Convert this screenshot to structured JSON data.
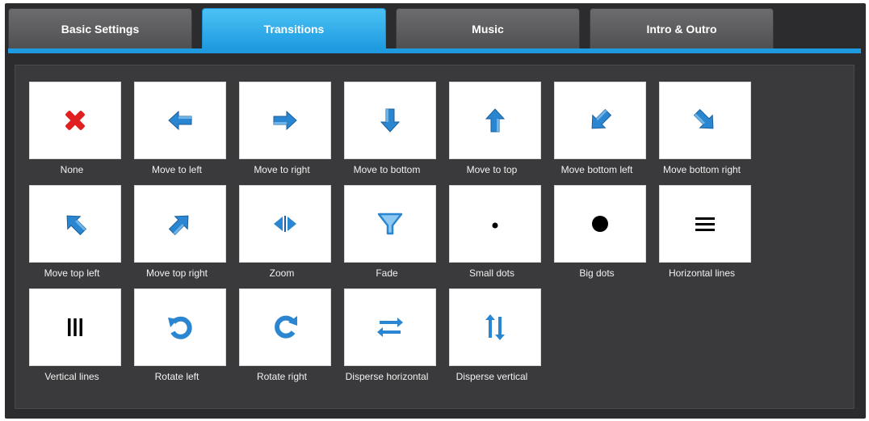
{
  "colors": {
    "accent": "#1e9be0",
    "icon_blue": "#2a86d1",
    "none_red": "#e02020",
    "panel_bg": "#3a3a3c",
    "frame_bg": "#2c2c2e"
  },
  "tabs": [
    {
      "label": "Basic Settings",
      "active": false
    },
    {
      "label": "Transitions",
      "active": true
    },
    {
      "label": "Music",
      "active": false
    },
    {
      "label": "Intro & Outro",
      "active": false
    }
  ],
  "transitions": [
    {
      "label": "None",
      "icon": "x-icon"
    },
    {
      "label": "Move to left",
      "icon": "arrow-left-icon"
    },
    {
      "label": "Move to right",
      "icon": "arrow-right-icon"
    },
    {
      "label": "Move to bottom",
      "icon": "arrow-down-icon"
    },
    {
      "label": "Move to top",
      "icon": "arrow-up-icon"
    },
    {
      "label": "Move bottom left",
      "icon": "arrow-down-left-icon"
    },
    {
      "label": "Move bottom right",
      "icon": "arrow-down-right-icon"
    },
    {
      "label": "Move top left",
      "icon": "arrow-up-left-icon"
    },
    {
      "label": "Move top right",
      "icon": "arrow-up-right-icon"
    },
    {
      "label": "Zoom",
      "icon": "zoom-icon"
    },
    {
      "label": "Fade",
      "icon": "funnel-icon"
    },
    {
      "label": "Small dots",
      "icon": "small-dot-icon"
    },
    {
      "label": "Big dots",
      "icon": "big-dot-icon"
    },
    {
      "label": "Horizontal lines",
      "icon": "horizontal-lines-icon"
    },
    {
      "label": "Vertical lines",
      "icon": "vertical-lines-icon"
    },
    {
      "label": "Rotate left",
      "icon": "rotate-left-icon"
    },
    {
      "label": "Rotate right",
      "icon": "rotate-right-icon"
    },
    {
      "label": "Disperse horizontal",
      "icon": "disperse-horizontal-icon"
    },
    {
      "label": "Disperse vertical",
      "icon": "disperse-vertical-icon"
    }
  ]
}
